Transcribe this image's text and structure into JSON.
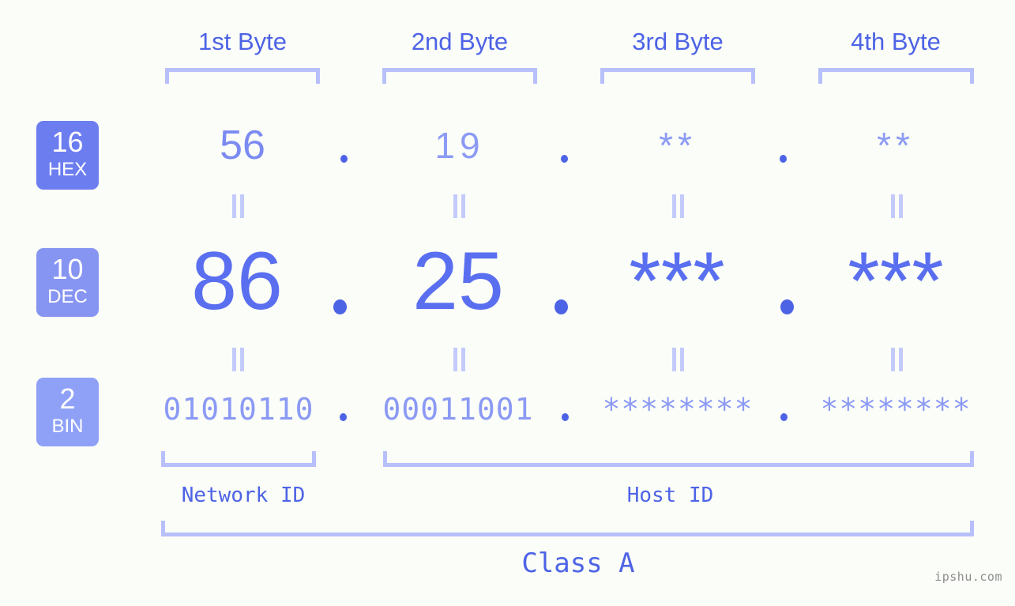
{
  "background_color": "#fbfdf8",
  "accent_color": "#4d63e6",
  "bracket_color": "#b7c0fb",
  "byte_headers": [
    {
      "label": "1st Byte"
    },
    {
      "label": "2nd Byte"
    },
    {
      "label": "3rd Byte"
    },
    {
      "label": "4th Byte"
    }
  ],
  "rows": [
    {
      "radix_number": "16",
      "radix_name": "HEX",
      "badge_color": "#6c7df0",
      "values": [
        "56",
        "19",
        "**",
        "**"
      ],
      "separator": "."
    },
    {
      "radix_number": "10",
      "radix_name": "DEC",
      "badge_color": "#8795f2",
      "values": [
        "86",
        "25",
        "***",
        "***"
      ],
      "separator": "."
    },
    {
      "radix_number": "2",
      "radix_name": "BIN",
      "badge_color": "#8fa1f7",
      "values": [
        "01010110",
        "00011001",
        "********",
        "********"
      ],
      "separator": "."
    }
  ],
  "equals_symbol": "=",
  "id_labels": {
    "network": "Network ID",
    "host": "Host ID"
  },
  "class_label": "Class A",
  "watermark": "ipshu.com"
}
